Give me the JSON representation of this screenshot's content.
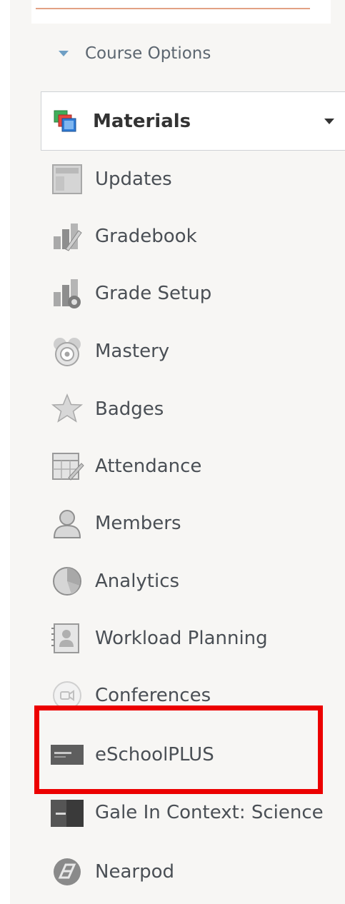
{
  "course_options": {
    "label": "Course Options",
    "icon": "triangle-down-icon"
  },
  "materials": {
    "label": "Materials",
    "icon": "materials-icon",
    "caret_icon": "caret-down-icon"
  },
  "nav": {
    "items": [
      {
        "label": "Updates",
        "icon": "updates-icon"
      },
      {
        "label": "Gradebook",
        "icon": "gradebook-icon"
      },
      {
        "label": "Grade Setup",
        "icon": "grade-setup-icon"
      },
      {
        "label": "Mastery",
        "icon": "mastery-icon"
      },
      {
        "label": "Badges",
        "icon": "badges-icon"
      },
      {
        "label": "Attendance",
        "icon": "attendance-icon"
      },
      {
        "label": "Members",
        "icon": "members-icon"
      },
      {
        "label": "Analytics",
        "icon": "analytics-icon"
      },
      {
        "label": "Workload Planning",
        "icon": "workload-planning-icon"
      },
      {
        "label": "Conferences",
        "icon": "conferences-icon"
      },
      {
        "label": "eSchoolPLUS",
        "icon": "eschoolplus-icon"
      },
      {
        "label": "Gale In Context: Science",
        "icon": "gale-icon"
      },
      {
        "label": "Nearpod",
        "icon": "nearpod-icon"
      }
    ]
  },
  "highlight": {
    "color": "#ec0000",
    "target": "eSchoolPLUS"
  },
  "colors": {
    "sidebar_bg": "#f7f6f4",
    "text": "#4a4f55",
    "accent_blue": "#6f9fc4"
  }
}
